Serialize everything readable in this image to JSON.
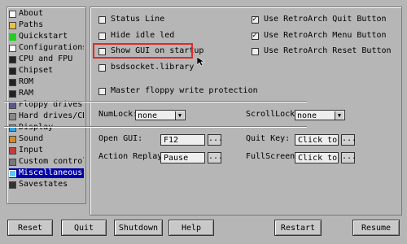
{
  "sidebar": {
    "items": [
      {
        "label": "About",
        "icon": "info-icon"
      },
      {
        "label": "Paths",
        "icon": "folder-icon"
      },
      {
        "label": "Quickstart",
        "icon": "play-icon"
      },
      {
        "label": "Configurations",
        "icon": "settings-icon"
      },
      {
        "label": "CPU and FPU",
        "icon": "chip-icon"
      },
      {
        "label": "Chipset",
        "icon": "chip-icon"
      },
      {
        "label": "ROM",
        "icon": "chip-icon"
      },
      {
        "label": "RAM",
        "icon": "chip-icon"
      },
      {
        "label": "Floppy drives",
        "icon": "floppy-icon"
      },
      {
        "label": "Hard drives/CD",
        "icon": "harddrive-icon"
      },
      {
        "label": "Display",
        "icon": "monitor-icon"
      },
      {
        "label": "Sound",
        "icon": "sound-icon"
      },
      {
        "label": "Input",
        "icon": "joystick-icon"
      },
      {
        "label": "Custom controls",
        "icon": "gamepad-icon"
      },
      {
        "label": "Miscellaneous",
        "icon": "misc-icon"
      },
      {
        "label": "Savestates",
        "icon": "disk-icon"
      }
    ],
    "selected_index": 14
  },
  "checkboxes": {
    "status_line": {
      "label": "Status Line",
      "checked": false
    },
    "hide_idle_led": {
      "label": "Hide idle led",
      "checked": false
    },
    "show_gui": {
      "label": "Show GUI on startup",
      "checked": false
    },
    "bsdsocket": {
      "label": "bsdsocket.library",
      "checked": false
    },
    "master_floppy": {
      "label": "Master floppy write protection",
      "checked": false
    },
    "ra_quit": {
      "label": "Use RetroArch Quit Button",
      "checked": true
    },
    "ra_menu": {
      "label": "Use RetroArch Menu Button",
      "checked": true
    },
    "ra_reset": {
      "label": "Use RetroArch Reset Button",
      "checked": false
    }
  },
  "locks": {
    "numlock": {
      "label": "NumLock:",
      "value": "none"
    },
    "scrolllock": {
      "label": "ScrollLock:",
      "value": "none"
    }
  },
  "keys": {
    "open_gui": {
      "label": "Open GUI:",
      "value": "F12"
    },
    "quit_key": {
      "label": "Quit Key:",
      "value": "Click to m"
    },
    "action_replay": {
      "label": "Action Replay:",
      "value": "Pause"
    },
    "fullscreen": {
      "label": "FullScreen:",
      "value": "Click to m"
    },
    "dots_label": "..."
  },
  "buttons": {
    "reset": "Reset",
    "quit": "Quit",
    "shutdown": "Shutdown",
    "help": "Help",
    "restart": "Restart",
    "resume": "Resume"
  },
  "colors": {
    "background": "#b6b6b6",
    "selection": "#0000aa",
    "highlight": "#e02a2a"
  }
}
